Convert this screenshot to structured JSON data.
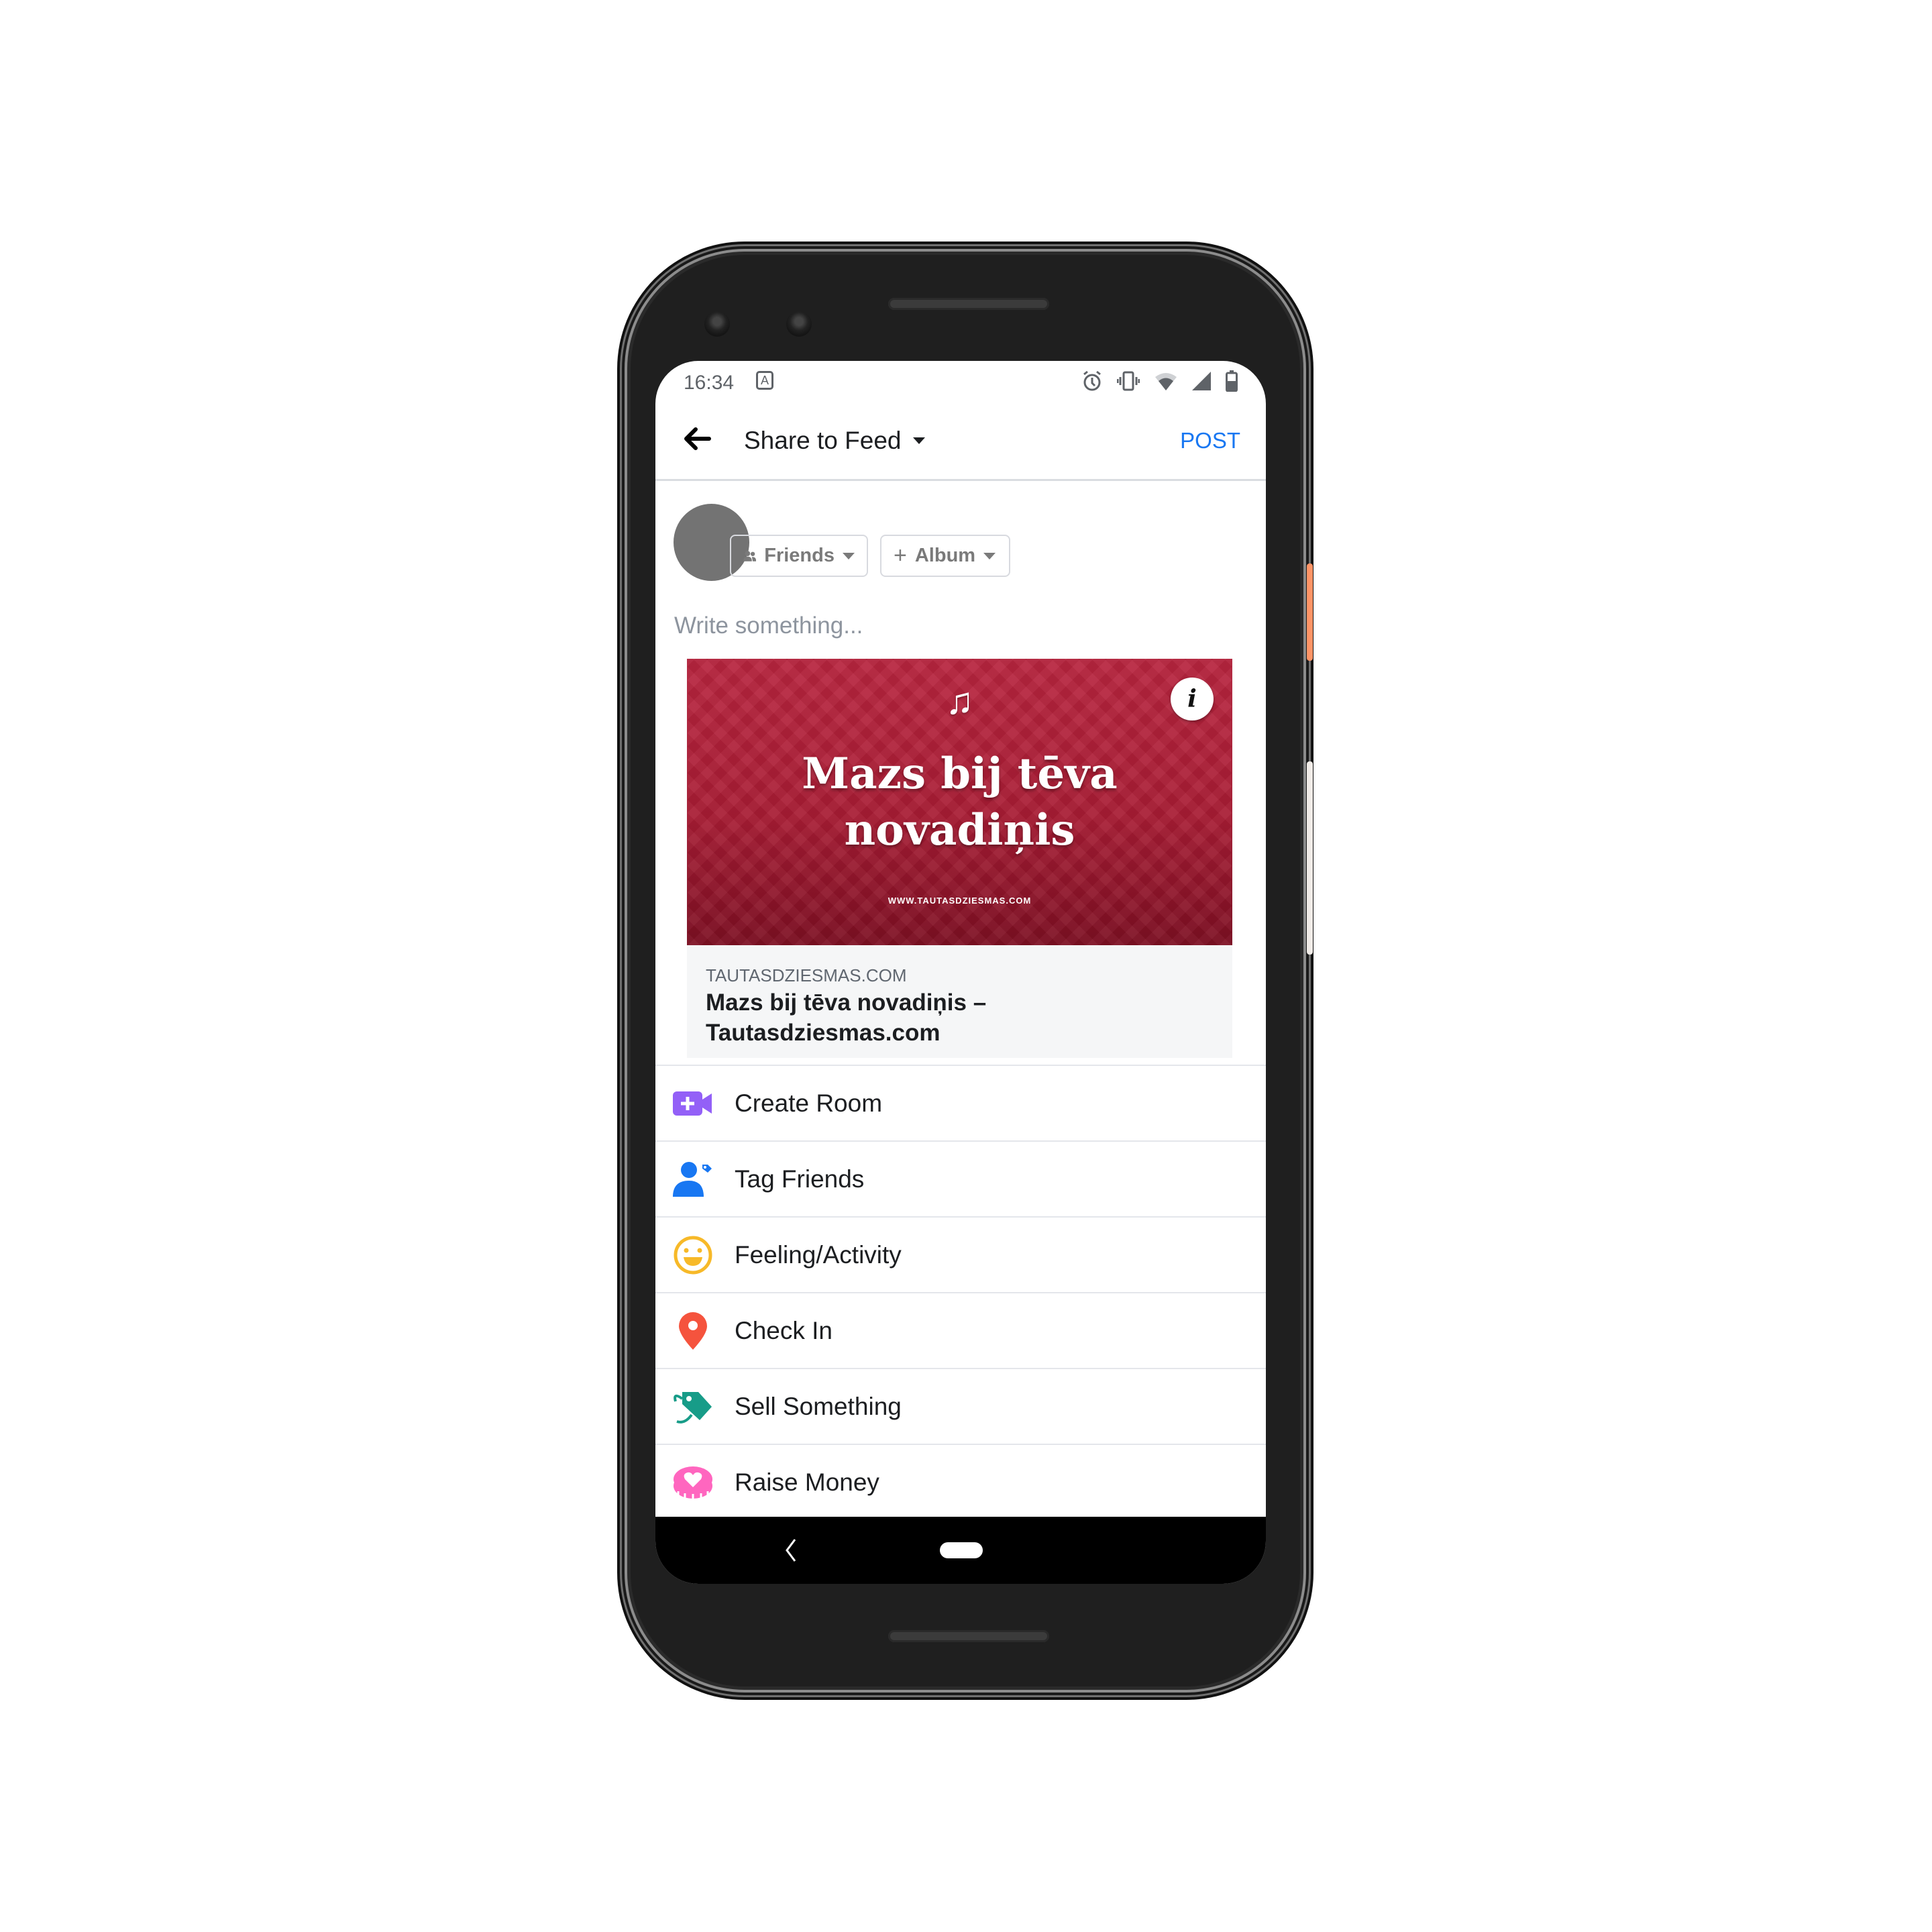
{
  "status_bar": {
    "time": "16:34",
    "notification_icon": "A",
    "icons": [
      "alarm-icon",
      "vibrate-icon",
      "wifi-icon",
      "signal-icon",
      "battery-icon"
    ]
  },
  "app_bar": {
    "title": "Share to Feed",
    "post_label": "POST"
  },
  "audience": {
    "friends_label": "Friends",
    "album_label": "Album"
  },
  "composer": {
    "placeholder": "Write something..."
  },
  "link_preview": {
    "image_title_line1": "Mazs bij tēva",
    "image_title_line2": "novadiņis",
    "image_url_text": "WWW.TAUTASDZIESMAS.COM",
    "info_glyph": "i",
    "domain": "TAUTASDZIESMAS.COM",
    "title_line1": "Mazs bij tēva novadiņis –",
    "title_line2": "Tautasdziesmas.com"
  },
  "actions": [
    {
      "label": "Create Room",
      "icon": "video-plus-icon",
      "color": "#9360f7"
    },
    {
      "label": "Tag Friends",
      "icon": "tag-friends-icon",
      "color": "#1877f2"
    },
    {
      "label": "Feeling/Activity",
      "icon": "smiley-icon",
      "color": "#f7b928"
    },
    {
      "label": "Check In",
      "icon": "location-pin-icon",
      "color": "#f5533d"
    },
    {
      "label": "Sell Something",
      "icon": "price-tag-icon",
      "color": "#179c88"
    },
    {
      "label": "Raise Money",
      "icon": "heart-coin-icon",
      "color": "#ff66bf"
    }
  ],
  "colors": {
    "accent": "#1877f2",
    "card_red": "#a81c34"
  }
}
